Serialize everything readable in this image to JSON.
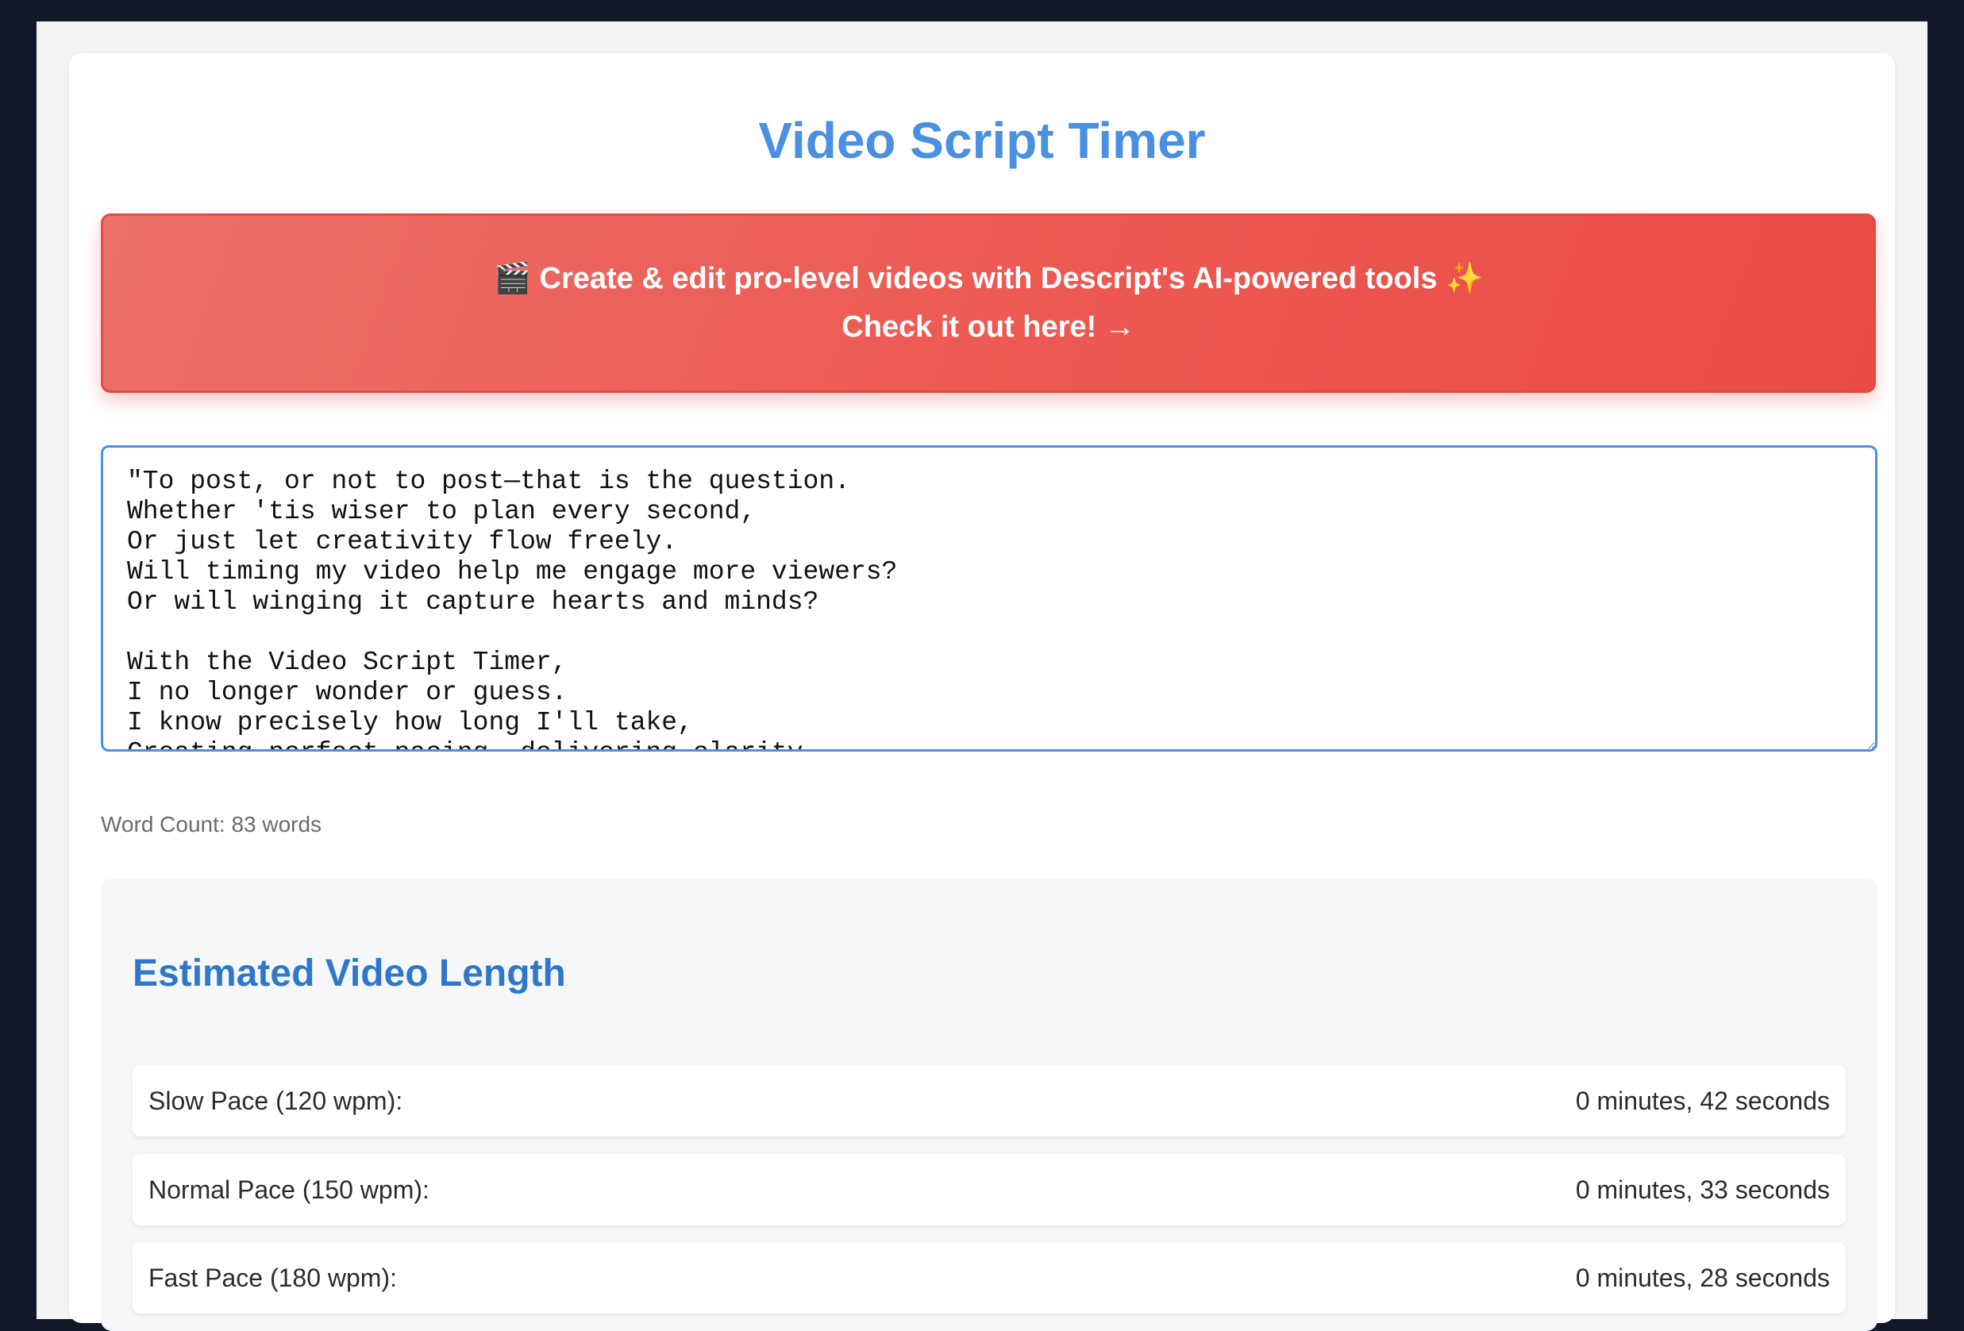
{
  "app": {
    "title": "Video Script Timer"
  },
  "promo": {
    "clapper_icon": "🎬",
    "line1_text": "Create & edit pro-level videos with Descript's AI-powered tools",
    "sparkle_icon": "✨",
    "line2_text": "Check it out here! →",
    "background_color": "#ec5a53"
  },
  "script": {
    "value": "\"To post, or not to post—that is the question.\nWhether 'tis wiser to plan every second,\nOr just let creativity flow freely.\nWill timing my video help me engage more viewers?\nOr will winging it capture hearts and minds?\n\nWith the Video Script Timer,\nI no longer wonder or guess.\nI know precisely how long I'll take,\nCreating perfect pacing, delivering clarity."
  },
  "word_count": {
    "text": "Word Count: 83 words"
  },
  "results": {
    "heading": "Estimated Video Length",
    "paces": [
      {
        "label": "Slow Pace (120 wpm):",
        "value": "0 minutes, 42 seconds"
      },
      {
        "label": "Normal Pace (150 wpm):",
        "value": "0 minutes, 33 seconds"
      },
      {
        "label": "Fast Pace (180 wpm):",
        "value": "0 minutes, 28 seconds"
      }
    ]
  },
  "colors": {
    "accent": "#4a90e2",
    "heading_blue": "#2f78c9",
    "promo_red": "#ec5a53",
    "outer_background": "#111827"
  }
}
